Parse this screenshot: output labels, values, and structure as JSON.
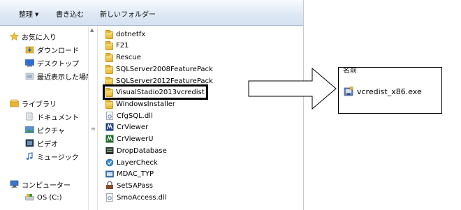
{
  "toolbar": {
    "organize": "整理",
    "burn": "書き込む",
    "new_folder": "新しいフォルダー"
  },
  "nav": {
    "favorites_label": "お気に入り",
    "favorites": [
      "ダウンロード",
      "デスクトップ",
      "最近表示した場所"
    ],
    "libraries_label": "ライブラリ",
    "libraries": [
      "ドキュメント",
      "ピクチャ",
      "ビデオ",
      "ミュージック"
    ],
    "computer_label": "コンピューター",
    "computer": [
      "OS (C:)"
    ]
  },
  "files": [
    {
      "name": "dotnetfx",
      "icon": "folder-icon"
    },
    {
      "name": "F21",
      "icon": "folder-icon"
    },
    {
      "name": "Rescue",
      "icon": "folder-icon"
    },
    {
      "name": "SQLServer2008FeaturePack",
      "icon": "folder-icon"
    },
    {
      "name": "SQLServer2012FeaturePack",
      "icon": "folder-icon"
    },
    {
      "name": "VisualStadio2013vcredist",
      "icon": "folder-icon"
    },
    {
      "name": "WindowsInstaller",
      "icon": "folder-icon"
    },
    {
      "name": "CfgSQL.dll",
      "icon": "dll-icon"
    },
    {
      "name": "CrViewer",
      "icon": "crviewer-icon"
    },
    {
      "name": "CrViewerU",
      "icon": "crvieweru-icon"
    },
    {
      "name": "DropDatabase",
      "icon": "database-icon"
    },
    {
      "name": "LayerCheck",
      "icon": "layercheck-icon"
    },
    {
      "name": "MDAC_TYP",
      "icon": "installer-icon"
    },
    {
      "name": "SetSAPass",
      "icon": "setsapass-icon"
    },
    {
      "name": "SmoAccess.dll",
      "icon": "dll-icon"
    }
  ],
  "panel": {
    "header": "名前",
    "file": "vcredist_x86.exe"
  },
  "colors": {
    "toolbar_bg": "#dfe9f5",
    "folder_yellow": "#e8b634",
    "highlight_border": "#000000"
  }
}
